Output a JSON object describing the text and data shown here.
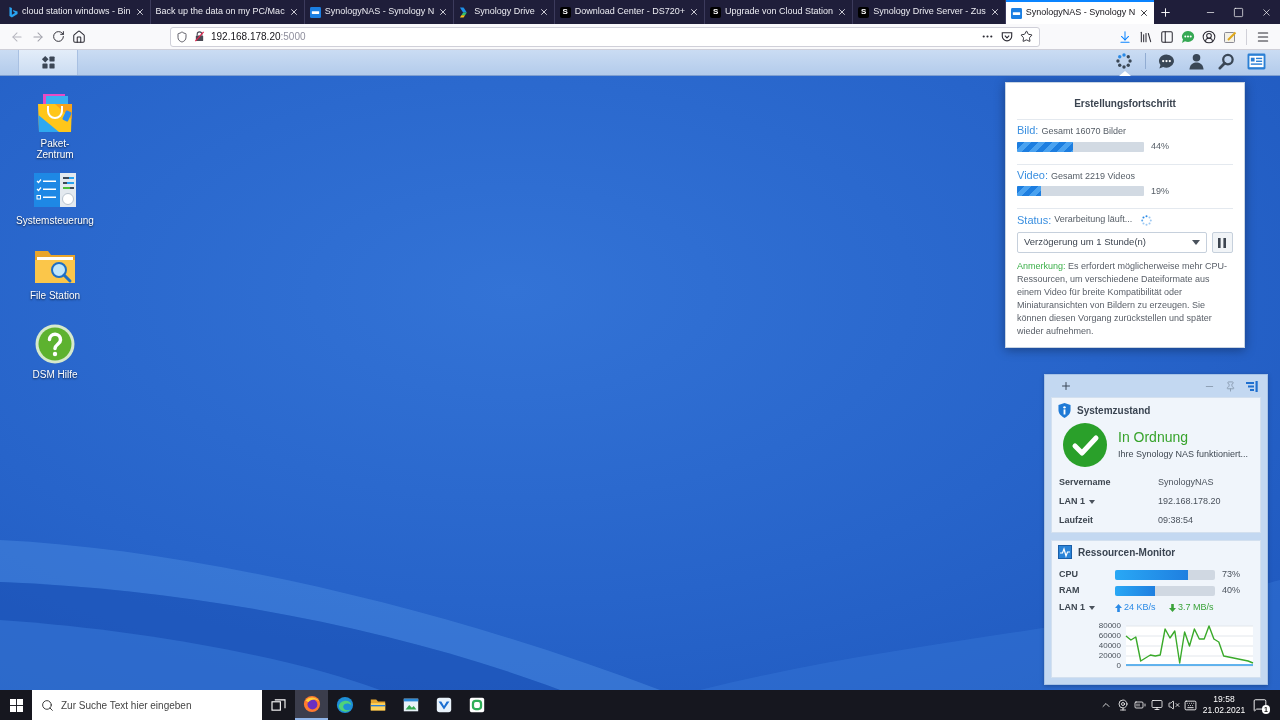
{
  "browser": {
    "tabs": [
      {
        "title": "cloud station windows - Bin",
        "favicon": {
          "kind": "bing"
        },
        "selected": false
      },
      {
        "title": "Back up the data on my PC/Mac",
        "selected": false
      },
      {
        "title": "SynologyNAS - Synology N",
        "favicon": {
          "kind": "dsm"
        },
        "selected": false
      },
      {
        "title": "Synology Drive",
        "favicon": {
          "kind": "drive"
        },
        "selected": false
      },
      {
        "title": "Download Center - DS720+",
        "favicon": {
          "kind": "letter",
          "text": "S"
        },
        "selected": false
      },
      {
        "title": "Upgrade von Cloud Station",
        "favicon": {
          "kind": "letter",
          "text": "S"
        },
        "selected": false
      },
      {
        "title": "Synology Drive Server - Zus",
        "favicon": {
          "kind": "letter",
          "text": "S"
        },
        "selected": false
      },
      {
        "title": "SynologyNAS - Synology N",
        "favicon": {
          "kind": "dsm"
        },
        "selected": true
      }
    ],
    "navigation": {
      "back_disabled": true,
      "forward_disabled": true
    },
    "address_bar": {
      "host": "192.168.178.20",
      "port": ":5000"
    }
  },
  "desktop": {
    "shortcuts": [
      {
        "label": "Paket-Zentrum",
        "kind": "package"
      },
      {
        "label": "Systemsteuerung",
        "kind": "control_panel"
      },
      {
        "label": "File Station",
        "kind": "file_station"
      },
      {
        "label": "DSM Hilfe",
        "kind": "help"
      }
    ]
  },
  "progress_popup": {
    "title": "Erstellungsfortschritt",
    "items": [
      {
        "label": "Bild:",
        "detail": "Gesamt 16070 Bilder",
        "level": 0.44,
        "percent": "44%"
      },
      {
        "label": "Video:",
        "detail": "Gesamt 2219 Videos",
        "level": 0.19,
        "percent": "19%"
      }
    ],
    "status": {
      "label": "Status:",
      "value": "Verarbeitung läuft..."
    },
    "delay_select": {
      "value": "Verzögerung um 1 Stunde(n)"
    },
    "note": {
      "label": "Anmerkung:",
      "text": "Es erfordert möglicherweise mehr CPU-Ressourcen, um verschiedene Dateiformate aus einem Video für breite Kompatibilität oder Miniaturansichten von Bildern zu erzeugen. Sie können diesen Vorgang zurückstellen und später wieder aufnehmen."
    }
  },
  "widgets": {
    "system_health": {
      "title": "Systemzustand",
      "status": "In Ordnung",
      "message": "Ihre Synology NAS funktioniert...",
      "rows": [
        {
          "label": "Servername",
          "value": "SynologyNAS",
          "kind": "text"
        },
        {
          "label": "LAN 1",
          "value": "192.168.178.20",
          "kind": "dropdown"
        },
        {
          "label": "Laufzeit",
          "value": "09:38:54",
          "kind": "text"
        }
      ]
    },
    "resource_monitor": {
      "title": "Ressourcen-Monitor",
      "meters": [
        {
          "label": "CPU",
          "level": 0.73,
          "reading": "73%"
        },
        {
          "label": "RAM",
          "level": 0.4,
          "reading": "40%"
        }
      ],
      "network": {
        "interface": "LAN 1",
        "upload": "24 KB/s",
        "download": "3.7 MB/s"
      },
      "chart_data": {
        "type": "line",
        "series": [
          {
            "color": "#3aaa2a",
            "values": [
              60000,
              52000,
              58000,
              10000,
              16000,
              22000,
              20000,
              22000,
              74000,
              56000,
              70000,
              6000,
              68000,
              40000,
              74000,
              54000,
              54000,
              80000,
              54000,
              48000,
              20000,
              18000,
              16000,
              14000,
              12000,
              10000,
              6000
            ]
          },
          {
            "color": "#2f9be8",
            "values": [
              2000,
              2000,
              2000,
              2000,
              2000,
              2000,
              2000,
              2000,
              2000,
              2000,
              2000,
              2000,
              2000,
              2000,
              2000,
              2000,
              2000,
              2000,
              2000,
              2000,
              2000,
              2000,
              2000,
              2000,
              2000,
              2000,
              2000
            ]
          }
        ],
        "ylim": [
          0,
          80000
        ],
        "yticks": [
          0,
          20000,
          40000,
          60000,
          80000
        ],
        "grid": true
      }
    }
  },
  "taskbar": {
    "search": {
      "placeholder": "Zur Suche Text hier eingeben"
    },
    "apps": [
      {
        "kind": "fox",
        "selected": true
      },
      {
        "kind": "swirl",
        "selected": false
      },
      {
        "kind": "folder",
        "selected": false
      },
      {
        "kind": "picture",
        "selected": false
      },
      {
        "kind": "chevron",
        "selected": false
      },
      {
        "kind": "drive",
        "selected": false
      }
    ],
    "clock": {
      "time": "19:58",
      "date": "21.02.2021"
    },
    "notifications": {
      "count": "1"
    }
  }
}
